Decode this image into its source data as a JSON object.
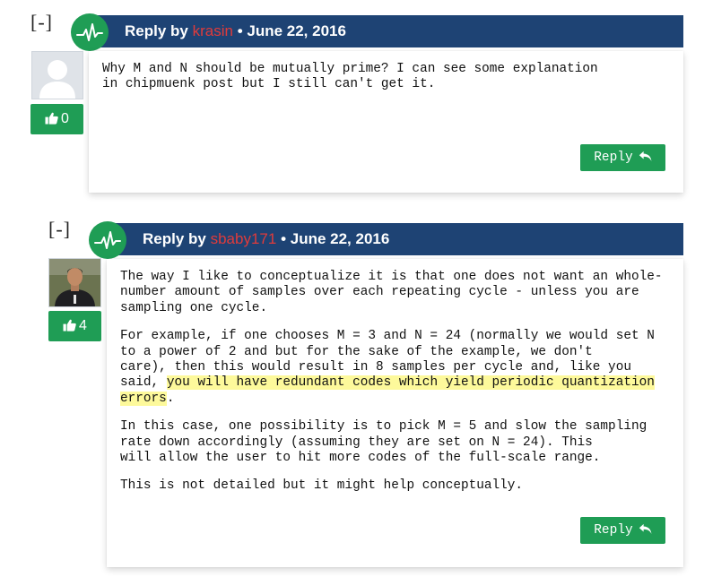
{
  "comments": [
    {
      "toggle": "[-]",
      "reply_by": "Reply by",
      "author": "krasin",
      "sep": "•",
      "date": "June 22, 2016",
      "votes": "0",
      "paragraphs": [
        "Why M and N should be mutually prime? I can see some explanation\nin chipmuenk post but I still can't get it."
      ],
      "reply_label": "Reply"
    },
    {
      "toggle": "[-]",
      "reply_by": "Reply by",
      "author": "sbaby171",
      "sep": "•",
      "date": "June 22, 2016",
      "votes": "4",
      "paragraphs": [
        "The way I like to conceptualize it is that one does not want an whole-\nnumber amount of samples over each repeating cycle - unless you are\nsampling one cycle.",
        {
          "before": "For example, if one chooses M = 3 and N = 24 (normally we would set N\nto a power of 2 and but for the sake of the example, we don't\ncare), then this would result in 8 samples per cycle and, like you\nsaid, ",
          "highlight": "you will have redundant codes which yield periodic quantization\nerrors",
          "after": "."
        },
        "In this case, one possibility is to pick M = 5 and slow the sampling\nrate down accordingly (assuming they are set on N = 24). This\nwill allow the user to hit more codes of the full-scale range.",
        "This is not detailed but it might help conceptually."
      ],
      "reply_label": "Reply"
    }
  ],
  "colors": {
    "header_bg": "#1e4374",
    "author": "#e03b3b",
    "green": "#1f9d55",
    "highlight": "#fdf99b"
  },
  "icons": [
    "waveform-logo-icon",
    "default-avatar-icon",
    "user-photo-avatar",
    "thumbs-up-icon",
    "reply-arrow-icon"
  ]
}
